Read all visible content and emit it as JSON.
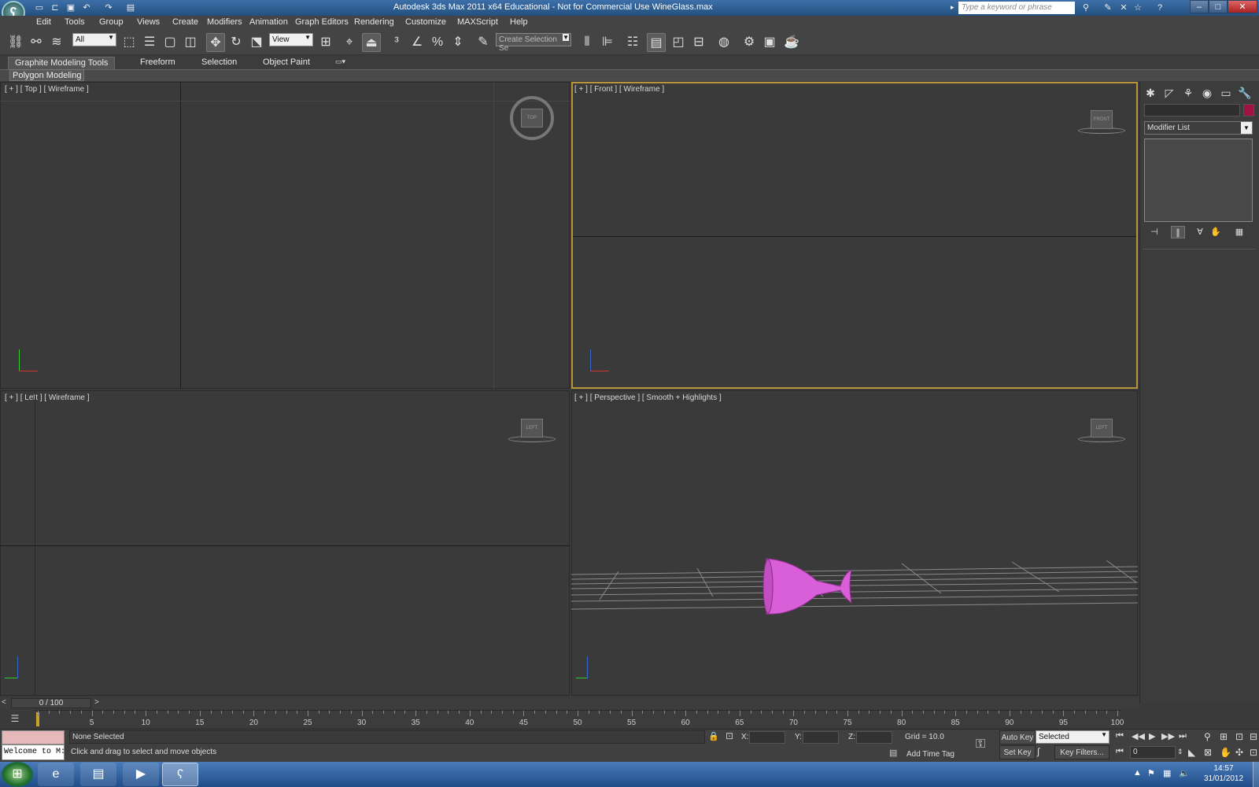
{
  "titlebar": {
    "title": "Autodesk 3ds Max  2011 x64    Educational  - Not for Commercial Use     WineGlass.max",
    "search_placeholder": "Type a keyword or phrase"
  },
  "menu": [
    "Edit",
    "Tools",
    "Group",
    "Views",
    "Create",
    "Modifiers",
    "Animation",
    "Graph Editors",
    "Rendering",
    "Customize",
    "MAXScript",
    "Help"
  ],
  "toolbar": {
    "selection_filter": "All",
    "ref_coord": "View",
    "named_selection": "Create Selection Se"
  },
  "ribbon": {
    "tabs": [
      "Graphite Modeling Tools",
      "Freeform",
      "Selection",
      "Object Paint"
    ],
    "panel": "Polygon Modeling"
  },
  "viewports": {
    "top": {
      "label": "[ + ] [ Top ] [ Wireframe ]",
      "cube": "TOP"
    },
    "front": {
      "label": "[ + ] [ Front ] [ Wireframe ]",
      "cube": "FRONT"
    },
    "left": {
      "label": "[ + ] [ Left ] [ Wireframe ]",
      "cube": "LEFT"
    },
    "perspective": {
      "label": "[ + ] [ Perspective ] [ Smooth + Highlights ]",
      "cube": "LEFT"
    }
  },
  "command_panel": {
    "modifier_list": "Modifier List",
    "object_color": "#a0123f"
  },
  "timeline": {
    "slider": "0 / 100",
    "ticks": [
      5,
      10,
      15,
      20,
      25,
      30,
      35,
      40,
      45,
      50,
      55,
      60,
      65,
      70,
      75,
      80,
      85,
      90,
      95,
      100
    ]
  },
  "status": {
    "listener": "Welcome to M:",
    "selection": "None Selected",
    "prompt": "Click and drag to select and move objects",
    "x_label": "X:",
    "y_label": "Y:",
    "z_label": "Z:",
    "grid": "Grid = 10.0",
    "add_time_tag": "Add Time Tag",
    "auto_key": "Auto Key",
    "set_key": "Set Key",
    "key_mode": "Selected",
    "key_filters": "Key Filters...",
    "frame": "0"
  },
  "taskbar": {
    "time": "14:57",
    "date": "31/01/2012"
  },
  "colors": {
    "wine_glass": "#d85fd8",
    "active_viewport_border": "#b8953a"
  }
}
